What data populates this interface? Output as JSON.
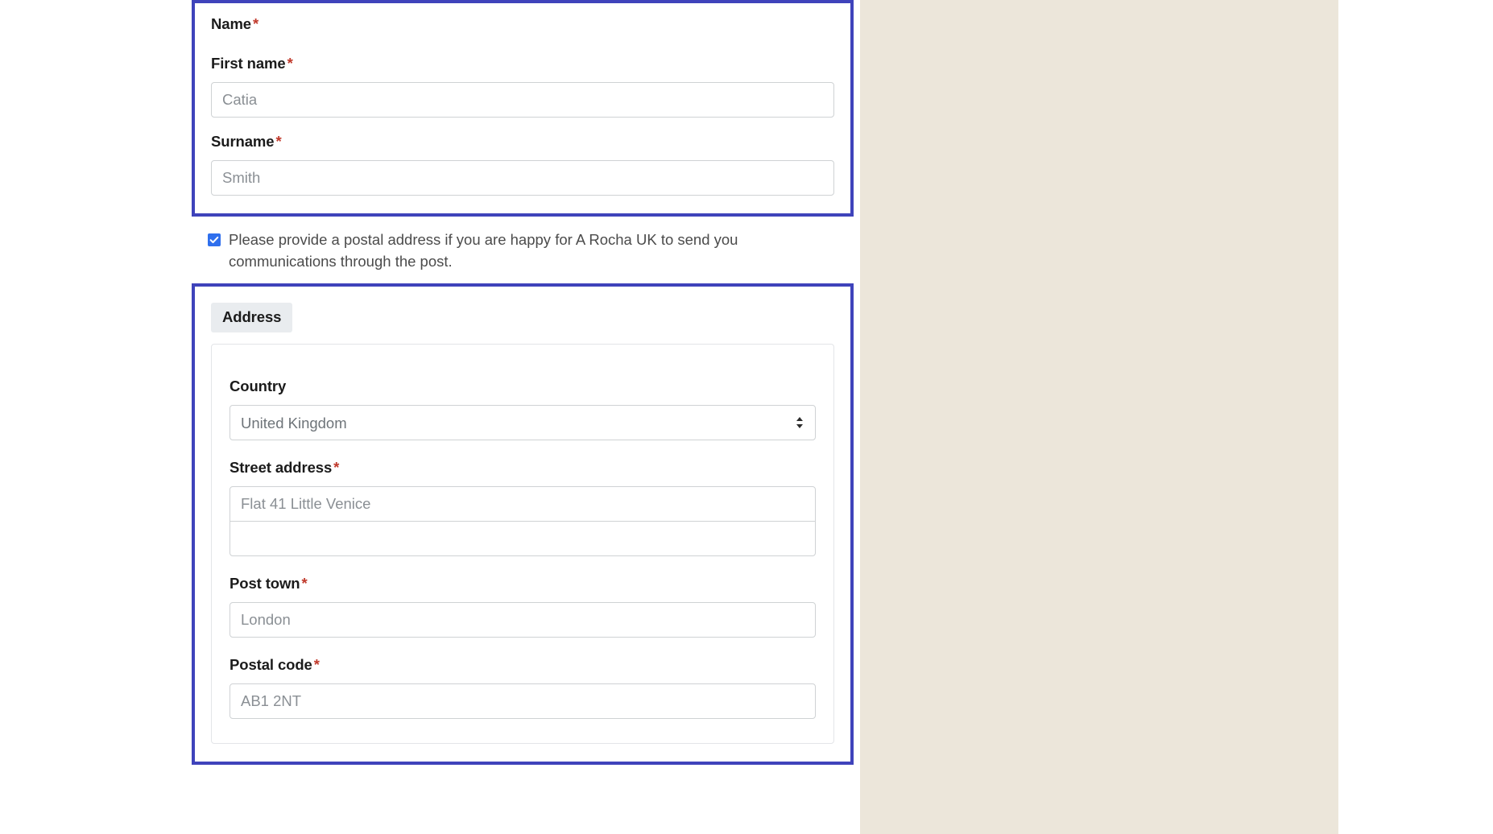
{
  "colors": {
    "highlight_border": "#3f43bb",
    "beige_panel": "#ece6da",
    "required_asterisk": "#c0392b",
    "checkbox_checked": "#2f6fed",
    "legend_background": "#e9ecef"
  },
  "name_group": {
    "title": "Name",
    "required_mark": "*",
    "fields": [
      {
        "label": "First name",
        "required_mark": "*",
        "placeholder": "Catia",
        "value": ""
      },
      {
        "label": "Surname",
        "required_mark": "*",
        "placeholder": "Smith",
        "value": ""
      }
    ]
  },
  "postal_consent": {
    "checked": true,
    "label": "Please provide a postal address if you are happy for A Rocha UK to send you communications through the post."
  },
  "address_group": {
    "legend": "Address",
    "country": {
      "label": "Country",
      "selected": "United Kingdom",
      "options": [
        "United Kingdom"
      ]
    },
    "street_address": {
      "label": "Street address",
      "required_mark": "*",
      "line1_placeholder": "Flat 41 Little Venice",
      "line1_value": "",
      "line2_placeholder": "",
      "line2_value": ""
    },
    "post_town": {
      "label": "Post town",
      "required_mark": "*",
      "placeholder": "London",
      "value": ""
    },
    "postal_code": {
      "label": "Postal code",
      "required_mark": "*",
      "placeholder": "AB1 2NT",
      "value": ""
    }
  }
}
